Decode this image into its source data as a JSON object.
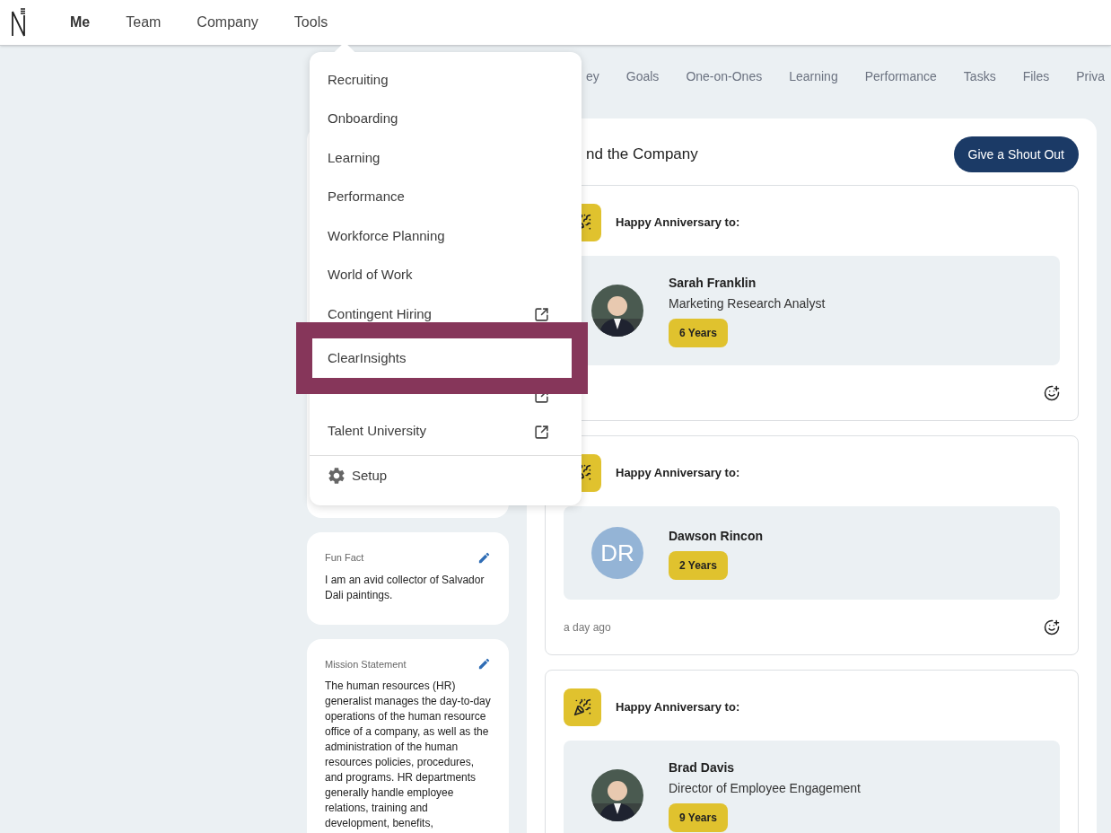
{
  "nav": {
    "items": [
      {
        "label": "Me",
        "selected": true
      },
      {
        "label": "Team",
        "selected": false
      },
      {
        "label": "Company",
        "selected": false
      },
      {
        "label": "Tools",
        "selected": false
      }
    ]
  },
  "tools_menu": {
    "items": [
      {
        "label": "Recruiting",
        "external": false,
        "highlighted": false
      },
      {
        "label": "Onboarding",
        "external": false,
        "highlighted": false
      },
      {
        "label": "Learning",
        "external": false,
        "highlighted": false
      },
      {
        "label": "Performance",
        "external": false,
        "highlighted": false
      },
      {
        "label": "Workforce Planning",
        "external": false,
        "highlighted": false
      },
      {
        "label": "World of Work",
        "external": false,
        "highlighted": false
      },
      {
        "label": "Contingent Hiring",
        "external": true,
        "highlighted": false
      },
      {
        "label": "ClearInsights",
        "external": false,
        "highlighted": true
      },
      {
        "external": true,
        "highlighted": false
      },
      {
        "label": "Talent University",
        "external": true,
        "highlighted": false
      }
    ],
    "setup": "Setup"
  },
  "tabs": [
    {
      "label": "ey",
      "selected": false
    },
    {
      "label": "Goals",
      "selected": false
    },
    {
      "label": "One-on-Ones",
      "selected": false
    },
    {
      "label": "Learning",
      "selected": false
    },
    {
      "label": "Performance",
      "selected": false
    },
    {
      "label": "Tasks",
      "selected": false
    },
    {
      "label": "Files",
      "selected": false
    },
    {
      "label": "Priva",
      "selected": false
    }
  ],
  "profile_cards": [
    {
      "label": "Fun Fact",
      "text": "I am an avid collector of Salvador Dali paintings."
    },
    {
      "label": "Mission Statement",
      "text": "The human resources (HR) generalist manages the day-to-day operations of the human resource office of a company, as well as the administration of the human resources policies, procedures, and programs. HR departments generally handle employee relations, training and development, benefits,"
    }
  ],
  "feed": {
    "title": "nd the Company",
    "button": "Give a Shout Out",
    "posts": [
      {
        "heading": "Happy Anniversary to:",
        "name": "Sarah Franklin",
        "title": "Marketing Research Analyst",
        "badge": "6 Years"
      },
      {
        "heading": "Happy Anniversary to:",
        "name": "Dawson Rincon",
        "badge": "2 Years",
        "avatar": {
          "kind": "initials",
          "initials": "DR"
        },
        "time": "a day ago"
      },
      {
        "heading": "Happy Anniversary to:",
        "name": "Brad Davis",
        "title": "Director of Employee Engagement",
        "badge": "9 Years"
      }
    ]
  }
}
